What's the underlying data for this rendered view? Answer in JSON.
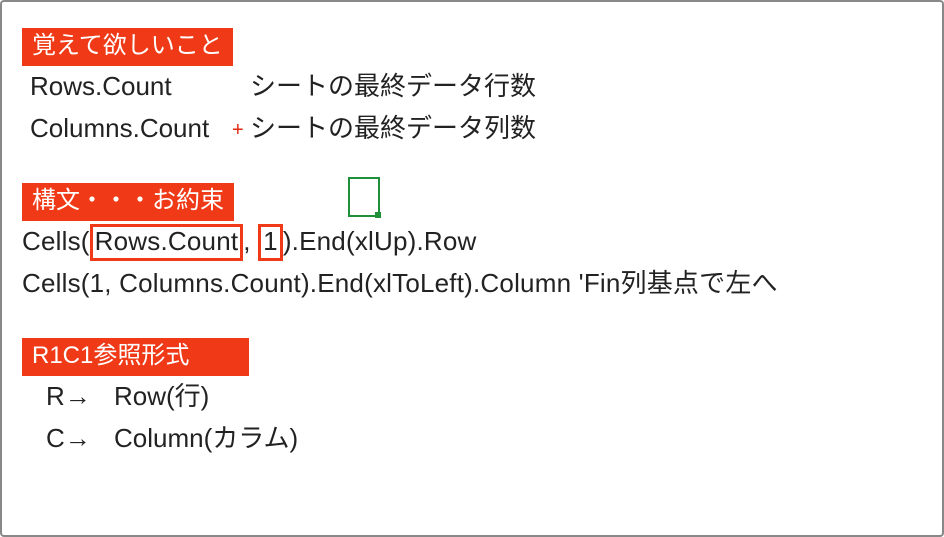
{
  "section1": {
    "heading": "覚えて欲しいこと",
    "rows": [
      {
        "term": "Rows.Count",
        "desc": "シートの最終データ行数",
        "plus": false
      },
      {
        "term": "Columns.Count",
        "desc": "シートの最終データ列数",
        "plus": true
      }
    ]
  },
  "section2": {
    "heading": "構文・・・お約束",
    "line1": {
      "prefix": "Cells(",
      "boxed1": "Rows.Count",
      "mid": ", ",
      "boxed2": "1",
      "suffix": ").End(xlUp).Row"
    },
    "line2": "Cells(1, Columns.Count).End(xlToLeft).Column 'Fin列基点で左へ"
  },
  "section3": {
    "heading": "R1C1参照形式",
    "rows": [
      {
        "lhs": "R→",
        "rhs": "Row(行)"
      },
      {
        "lhs": "C→",
        "rhs": "Column(カラム)"
      }
    ]
  },
  "colors": {
    "accent": "#f03a17"
  }
}
